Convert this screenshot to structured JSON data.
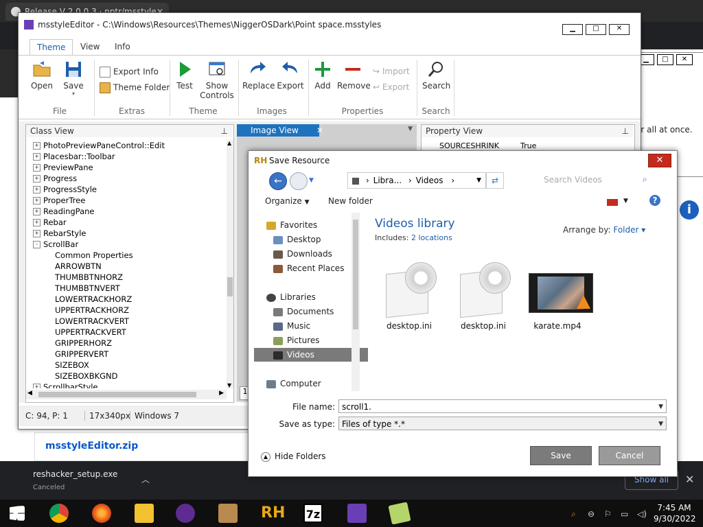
{
  "browser": {
    "tab_title": "Release V 2.0.0.3 · nptr/msstyle",
    "right_text": "er all at once.",
    "zip_link": "msstyleEditor.zip",
    "download_name": "reshacker_setup.exe",
    "download_status": "Canceled",
    "show_all": "Show all"
  },
  "editor": {
    "title": "msstyleEditor - C:\\Windows\\Resources\\Themes\\NiggerOSDark\\Point space.msstyles",
    "tabs": [
      "Theme",
      "View",
      "Info"
    ],
    "ribbon": {
      "open": "Open",
      "save": "Save",
      "group_file": "File",
      "export_info": "Export Info",
      "theme_folder": "Theme Folder",
      "group_extras": "Extras",
      "test": "Test",
      "show": "Show",
      "controls": "Controls",
      "group_theme": "Theme",
      "replace": "Replace",
      "export": "Export",
      "group_images": "Images",
      "add": "Add",
      "remove": "Remove",
      "import": "Import",
      "export2": "Export",
      "group_properties": "Properties",
      "search": "Search",
      "group_search": "Search"
    },
    "class_view": "Class View",
    "image_view": "Image View",
    "property_view": "Property View",
    "property_row_name": "SOURCESHRINK",
    "property_row_value": "True",
    "image_index": "1",
    "tree": [
      {
        "label": "PhotoPreviewPaneControl::Edit",
        "level": 0,
        "sign": "+"
      },
      {
        "label": "Placesbar::Toolbar",
        "level": 0,
        "sign": "+"
      },
      {
        "label": "PreviewPane",
        "level": 0,
        "sign": "+"
      },
      {
        "label": "Progress",
        "level": 0,
        "sign": "+"
      },
      {
        "label": "ProgressStyle",
        "level": 0,
        "sign": "+"
      },
      {
        "label": "ProperTree",
        "level": 0,
        "sign": "+"
      },
      {
        "label": "ReadingPane",
        "level": 0,
        "sign": "+"
      },
      {
        "label": "Rebar",
        "level": 0,
        "sign": "+"
      },
      {
        "label": "RebarStyle",
        "level": 0,
        "sign": "+"
      },
      {
        "label": "ScrollBar",
        "level": 0,
        "sign": "-"
      },
      {
        "label": "Common Properties",
        "level": 1,
        "sign": ""
      },
      {
        "label": "ARROWBTN",
        "level": 1,
        "sign": ""
      },
      {
        "label": "THUMBBTNHORZ",
        "level": 1,
        "sign": ""
      },
      {
        "label": "THUMBBTNVERT",
        "level": 1,
        "sign": ""
      },
      {
        "label": "LOWERTRACKHORZ",
        "level": 1,
        "sign": ""
      },
      {
        "label": "UPPERTRACKHORZ",
        "level": 1,
        "sign": ""
      },
      {
        "label": "LOWERTRACKVERT",
        "level": 1,
        "sign": ""
      },
      {
        "label": "UPPERTRACKVERT",
        "level": 1,
        "sign": ""
      },
      {
        "label": "GRIPPERHORZ",
        "level": 1,
        "sign": ""
      },
      {
        "label": "GRIPPERVERT",
        "level": 1,
        "sign": ""
      },
      {
        "label": "SIZEBOX",
        "level": 1,
        "sign": ""
      },
      {
        "label": "SIZEBOXBKGND",
        "level": 1,
        "sign": ""
      },
      {
        "label": "ScrollbarStyle",
        "level": 0,
        "sign": "+"
      }
    ],
    "status": {
      "pos": "C: 94, P: 1",
      "size": "17x340px",
      "os": "Windows 7"
    }
  },
  "dialog": {
    "title": "Save Resource",
    "addr_part1": "Libra...",
    "addr_part2": "Videos",
    "search_placeholder": "Search Videos",
    "organize": "Organize",
    "new_folder": "New folder",
    "nav": {
      "favorites": "Favorites",
      "desktop": "Desktop",
      "downloads": "Downloads",
      "recent": "Recent Places",
      "libraries": "Libraries",
      "documents": "Documents",
      "music": "Music",
      "pictures": "Pictures",
      "videos": "Videos",
      "computer": "Computer"
    },
    "library_title": "Videos library",
    "includes_label": "Includes:",
    "includes_value": "2 locations",
    "arrange_label": "Arrange by:",
    "arrange_value": "Folder",
    "files": [
      "desktop.ini",
      "desktop.ini",
      "karate.mp4"
    ],
    "file_name_label": "File name:",
    "file_name_value": "scroll1.",
    "save_type_label": "Save as type:",
    "save_type_value": "Files of type *.*",
    "hide_folders": "Hide Folders",
    "save_button": "Save",
    "cancel_button": "Cancel"
  },
  "taskbar": {
    "time": "7:45 AM",
    "date": "9/30/2022",
    "rh": "RH",
    "sevenzip": "7z"
  },
  "colors": {
    "accent": "#1e73be",
    "close_red": "#c42b1c",
    "link": "#1e5ea8"
  }
}
